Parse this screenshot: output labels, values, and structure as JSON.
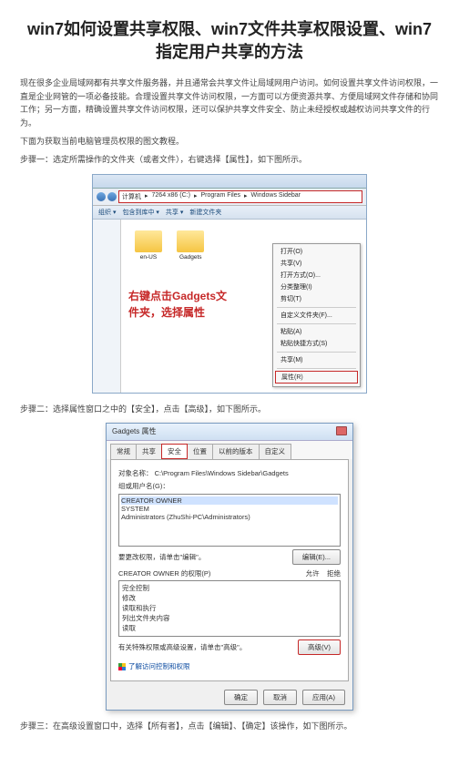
{
  "title": "win7如何设置共享权限、win7文件共享权限设置、win7指定用户共享的方法",
  "intro": "现在很多企业局域网都有共享文件服务器，并且通常会共享文件让局域网用户访问。如何设置共享文件访问权限，一直是企业网管的一项必备技能。合理设置共享文件访问权限，一方面可以方便资源共享、方便局域网文件存储和协同工作；另一方面，精确设置共享文件访问权限，还可以保护共享文件安全、防止未经授权或越权访问共享文件的行为。",
  "intro2": "下面为获取当前电脑管理员权限的图文教程。",
  "step1": "步骤一：选定所需操作的文件夹（或者文件），右键选择【属性】，如下图所示。",
  "step2": "步骤二：选择属性窗口之中的【安全】，点击【高级】，如下图所示。",
  "step3": "步骤三：在高级设置窗口中，选择【所有者】，点击【编辑】、【确定】该操作，如下图所示。",
  "fig1": {
    "address": {
      "seg1": "计算机",
      "seg2": "7264 x86 (C:)",
      "seg3": "Program Files",
      "seg4": "Windows Sidebar",
      "arrow": "▸"
    },
    "toolbar": "组织 ▾　包含到库中 ▾　共享 ▾　新建文件夹",
    "folders": {
      "f1": "en-US",
      "f2": "Gadgets"
    },
    "annot": "右键点击Gadgets文件夹，选择属性",
    "menu": {
      "m1": "打开(O)",
      "m2": "共享(V)",
      "m3": "打开方式(O)...",
      "m4": "分类整理(I)",
      "m5": "剪切(T)",
      "m6": "自定义文件夹(F)...",
      "m7": "粘贴(A)",
      "m8": "粘贴快捷方式(S)",
      "m9": "共享(M)",
      "m10": "属性(R)"
    }
  },
  "fig2": {
    "dlgTitle": "Gadgets 属性",
    "tabs": {
      "t1": "常规",
      "t2": "共享",
      "t3": "安全",
      "t4": "位置",
      "t5": "以前的版本",
      "t6": "自定义"
    },
    "objLabel": "对象名称：",
    "objPath": "C:\\Program Files\\Windows Sidebar\\Gadgets",
    "grpLabel": "组或用户名(G)：",
    "users": {
      "u1": "CREATOR OWNER",
      "u2": "SYSTEM",
      "u3": "Administrators (ZhuShi-PC\\Administrators)"
    },
    "editHint": "要更改权限，请单击\"编辑\"。",
    "editBtn": "编辑(E)...",
    "permHead": "CREATOR OWNER 的权限(P)",
    "allow": "允许",
    "deny": "拒绝",
    "perms": {
      "p1": "完全控制",
      "p2": "修改",
      "p3": "读取和执行",
      "p4": "列出文件夹内容",
      "p5": "读取"
    },
    "advHint": "有关特殊权限或高级设置，请单击\"高级\"。",
    "advBtn": "高级(V)",
    "aclLink": "了解访问控制和权限",
    "ok": "确定",
    "cancel": "取消",
    "apply": "应用(A)"
  }
}
